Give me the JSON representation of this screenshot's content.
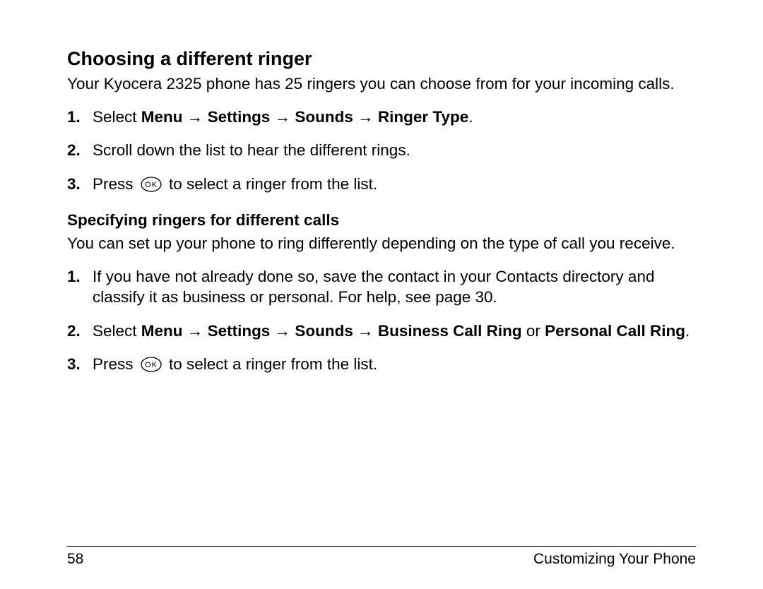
{
  "heading": "Choosing a different ringer",
  "intro": "Your Kyocera 2325 phone has 25 ringers you can choose from for your incoming calls.",
  "steps1": {
    "s1": {
      "num": "1.",
      "pre": "Select ",
      "m1": "Menu",
      "arr": " → ",
      "m2": "Settings",
      "m3": "Sounds",
      "m4": "Ringer Type",
      "post": "."
    },
    "s2": {
      "num": "2.",
      "text": "Scroll down the list to hear the different rings."
    },
    "s3": {
      "num": "3.",
      "pre": "Press ",
      "post": " to select a ringer from the list."
    }
  },
  "subheading": "Specifying ringers for different calls",
  "intro2": "You can set up your phone to ring differently depending on the type of call you receive.",
  "steps2": {
    "s1": {
      "num": "1.",
      "text": "If you have not already done so, save the contact in your Contacts directory and classify it as business or personal. For help, see page 30."
    },
    "s2": {
      "num": "2.",
      "pre": "Select ",
      "m1": "Menu",
      "arr": " → ",
      "m2": "Settings",
      "m3": "Sounds",
      "m4": "Business Call Ring",
      "or": " or ",
      "m5": "Personal Call Ring",
      "post": "."
    },
    "s3": {
      "num": "3.",
      "pre": "Press ",
      "post": " to select a ringer from the list."
    }
  },
  "footer": {
    "page_number": "58",
    "section": "Customizing Your Phone"
  },
  "icons": {
    "ok": "OK"
  }
}
